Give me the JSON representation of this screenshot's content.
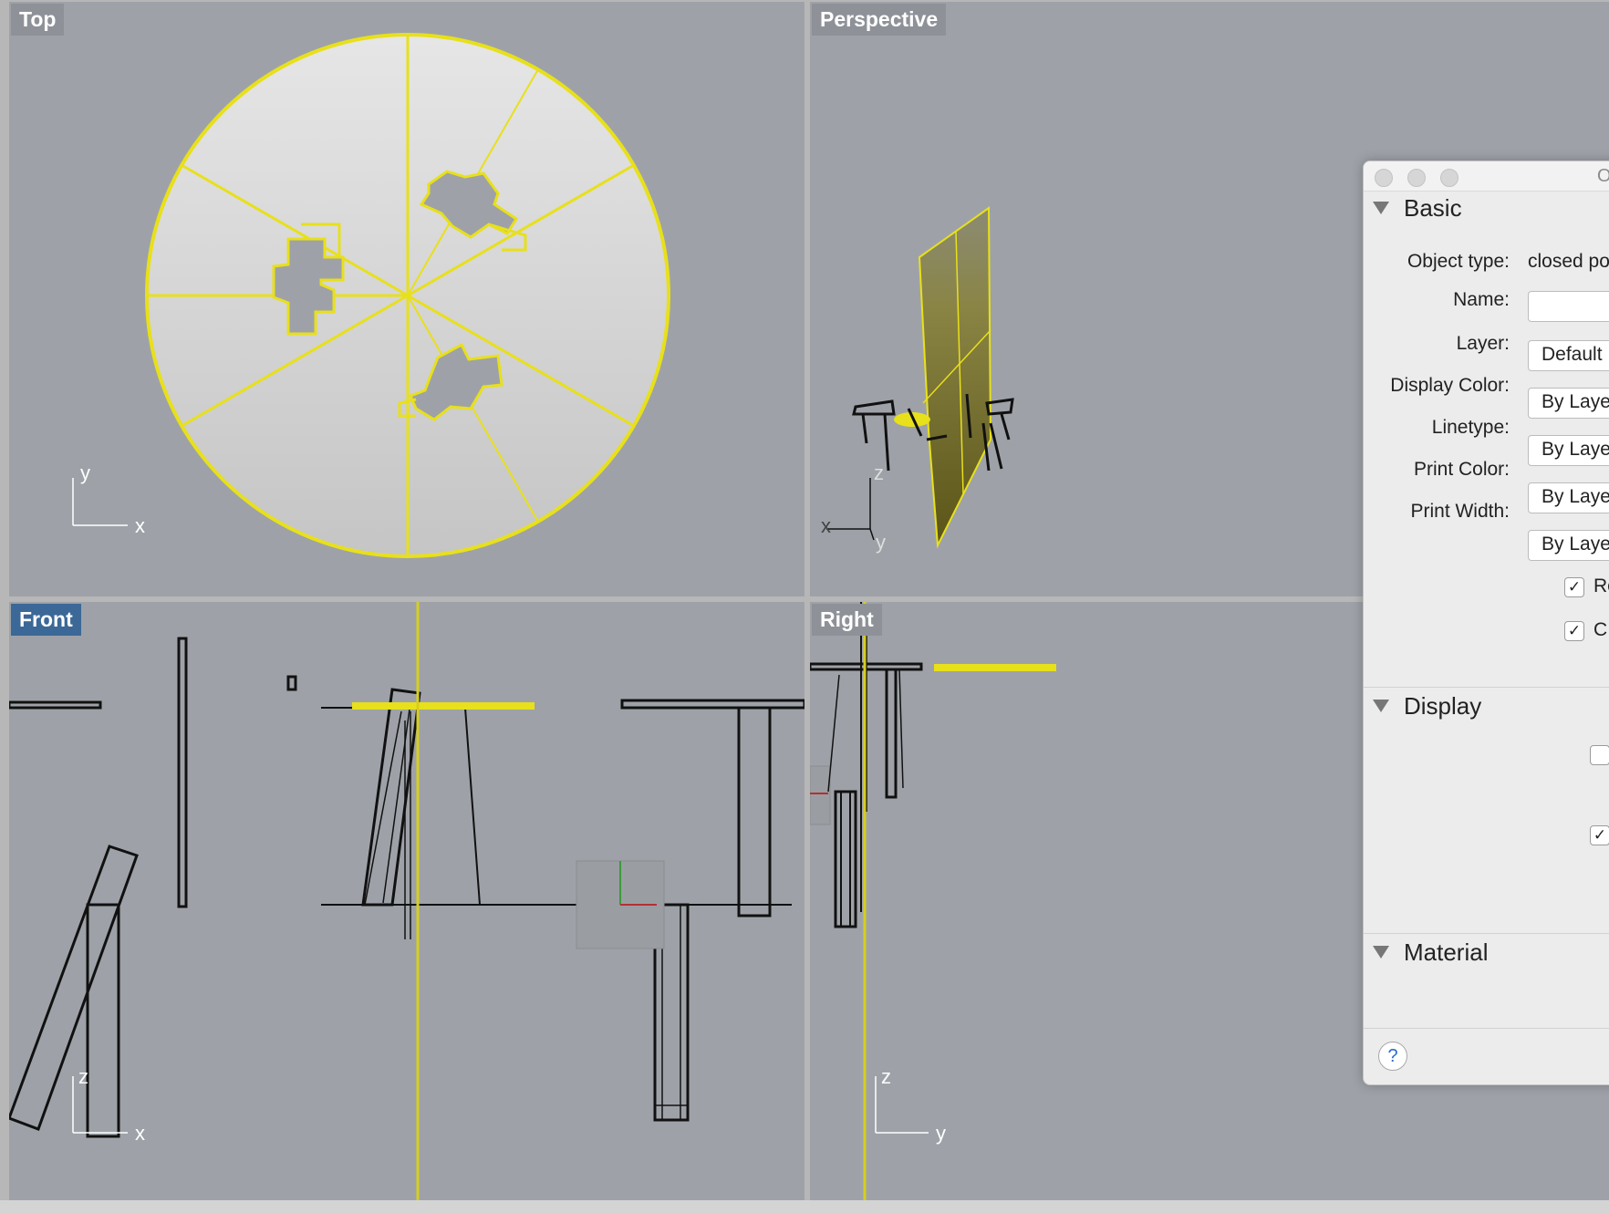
{
  "viewports": {
    "top": {
      "label": "Top",
      "axis_a": "y",
      "axis_b": "x"
    },
    "perspective": {
      "label": "Perspective",
      "axis_x": "x",
      "axis_y": "y",
      "axis_z": "z"
    },
    "front": {
      "label": "Front",
      "axis_a": "z",
      "axis_b": "x"
    },
    "right": {
      "label": "Right",
      "axis_a": "z",
      "axis_b": "y"
    }
  },
  "properties_panel": {
    "title_fragment": "O",
    "sections": {
      "basic": "Basic",
      "display": "Display",
      "material": "Material"
    },
    "fields": {
      "object_type_label": "Object type:",
      "object_type_value": "closed po",
      "name_label": "Name:",
      "name_value": "",
      "layer_label": "Layer:",
      "layer_value": "Default",
      "display_color_label": "Display Color:",
      "display_color_value": "By Laye",
      "linetype_label": "Linetype:",
      "linetype_value": "By Laye",
      "print_color_label": "Print Color:",
      "print_color_value": "By Laye",
      "print_width_label": "Print Width:",
      "print_width_value": "By Laye",
      "check1_label": "Re",
      "check2_label": "C"
    },
    "checkboxes": {
      "check1": "✓",
      "check2": "✓",
      "display_check1": "",
      "display_check2": "✓"
    },
    "help": "?"
  },
  "colors": {
    "viewport_bg": "#9ea2a8",
    "selection": "#e8e01a",
    "active_label": "#3b6897"
  }
}
